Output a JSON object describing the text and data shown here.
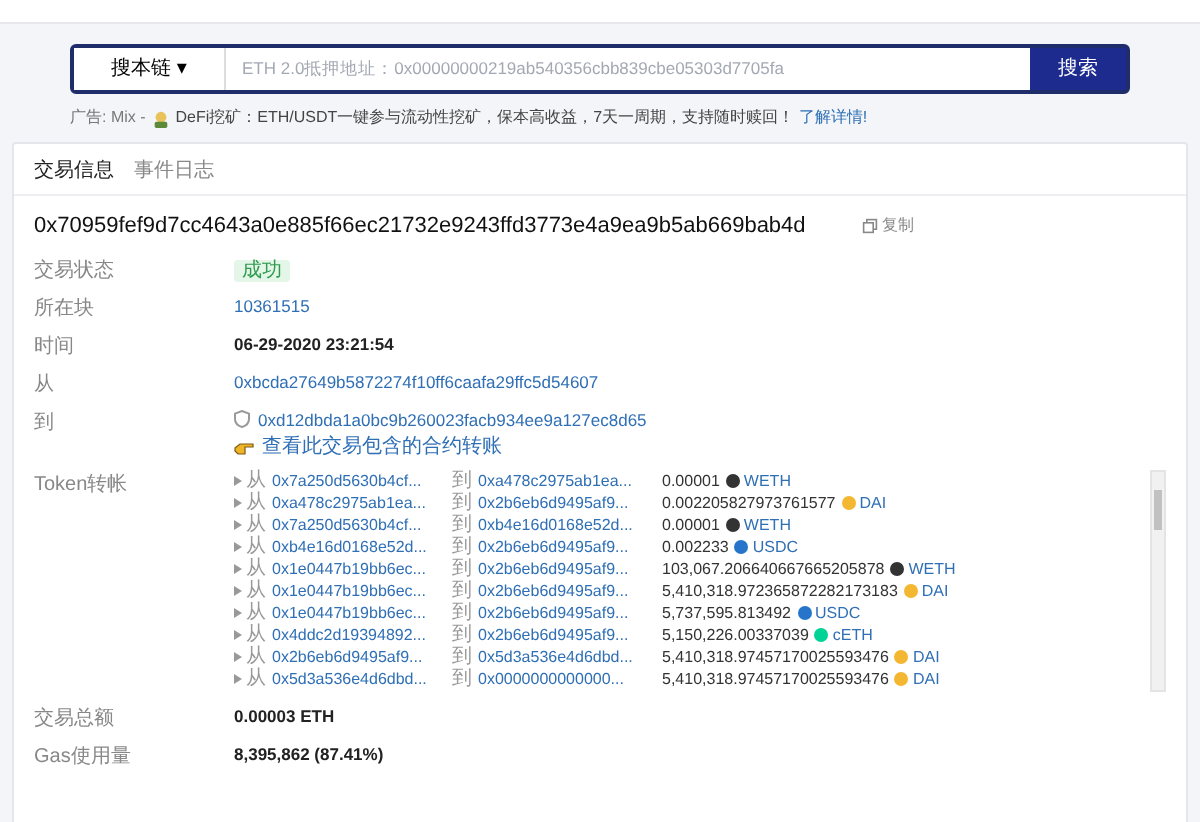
{
  "search": {
    "chain_selector": "搜本链",
    "caret": "▾",
    "placeholder": "ETH 2.0抵押地址：0x00000000219ab540356cbb839cbe05303d7705fa",
    "button": "搜索"
  },
  "ad": {
    "prefix": "广告: Mix - ",
    "text": "DeFi挖矿：ETH/USDT一键参与流动性挖矿，保本高收益，7天一周期，支持随时赎回！",
    "link": "了解详情!"
  },
  "tabs": [
    {
      "label": "交易信息",
      "selected": true
    },
    {
      "label": "事件日志",
      "selected": false
    }
  ],
  "tx_hash": "0x70959fef9d7cc4643a0e885f66ec21732e9243ffd3773e4a9ea9b5ab669bab4d",
  "copy_label": "复制",
  "fields": [
    {
      "kind": "badge",
      "label": "交易状态",
      "value": "成功"
    },
    {
      "kind": "link",
      "label": "所在块",
      "value": "10361515"
    },
    {
      "kind": "bold",
      "label": "时间",
      "value": "06-29-2020 23:21:54"
    },
    {
      "kind": "link",
      "label": "从",
      "value": "0xbcda27649b5872274f10ff6caafa29ffc5d54607"
    },
    {
      "kind": "contract",
      "label": "到",
      "value": "0xd12dbda1a0bc9b260023facb934ee9a127ec8d65",
      "note": "查看此交易包含的合约转账"
    }
  ],
  "token_transfers": {
    "label": "Token转帐",
    "rows": [
      {
        "from_label": "从",
        "from": "0x7a250d5630b4cf...",
        "to_label": "到",
        "to": "0xa478c2975ab1ea...",
        "amount": "0.00001",
        "token": "WETH",
        "color": "#333333"
      },
      {
        "from_label": "从",
        "from": "0xa478c2975ab1ea...",
        "to_label": "到",
        "to": "0x2b6eb6d9495af9...",
        "amount": "0.002205827973761577",
        "token": "DAI",
        "color": "#f4b731"
      },
      {
        "from_label": "从",
        "from": "0x7a250d5630b4cf...",
        "to_label": "到",
        "to": "0xb4e16d0168e52d...",
        "amount": "0.00001",
        "token": "WETH",
        "color": "#333333"
      },
      {
        "from_label": "从",
        "from": "0xb4e16d0168e52d...",
        "to_label": "到",
        "to": "0x2b6eb6d9495af9...",
        "amount": "0.002233",
        "token": "USDC",
        "color": "#2775ca"
      },
      {
        "from_label": "从",
        "from": "0x1e0447b19bb6ec...",
        "to_label": "到",
        "to": "0x2b6eb6d9495af9...",
        "amount": "103,067.206640667665205878",
        "token": "WETH",
        "color": "#333333"
      },
      {
        "from_label": "从",
        "from": "0x1e0447b19bb6ec...",
        "to_label": "到",
        "to": "0x2b6eb6d9495af9...",
        "amount": "5,410,318.972365872282173183",
        "token": "DAI",
        "color": "#f4b731"
      },
      {
        "from_label": "从",
        "from": "0x1e0447b19bb6ec...",
        "to_label": "到",
        "to": "0x2b6eb6d9495af9...",
        "amount": "5,737,595.813492",
        "token": "USDC",
        "color": "#2775ca"
      },
      {
        "from_label": "从",
        "from": "0x4ddc2d19394892...",
        "to_label": "到",
        "to": "0x2b6eb6d9495af9...",
        "amount": "5,150,226.00337039",
        "token": "cETH",
        "color": "#00d395"
      },
      {
        "from_label": "从",
        "from": "0x2b6eb6d9495af9...",
        "to_label": "到",
        "to": "0x5d3a536e4d6dbd...",
        "amount": "5,410,318.97457170025593476",
        "token": "DAI",
        "color": "#f4b731"
      },
      {
        "from_label": "从",
        "from": "0x5d3a536e4d6dbd...",
        "to_label": "到",
        "to": "0x0000000000000...",
        "amount": "5,410,318.97457170025593476",
        "token": "DAI",
        "color": "#f4b731"
      }
    ]
  },
  "fee": {
    "label": "交易总额",
    "value": "0.00003 ETH"
  },
  "gas": {
    "label": "Gas使用量",
    "value": "8,395,862 (87.41%)"
  }
}
